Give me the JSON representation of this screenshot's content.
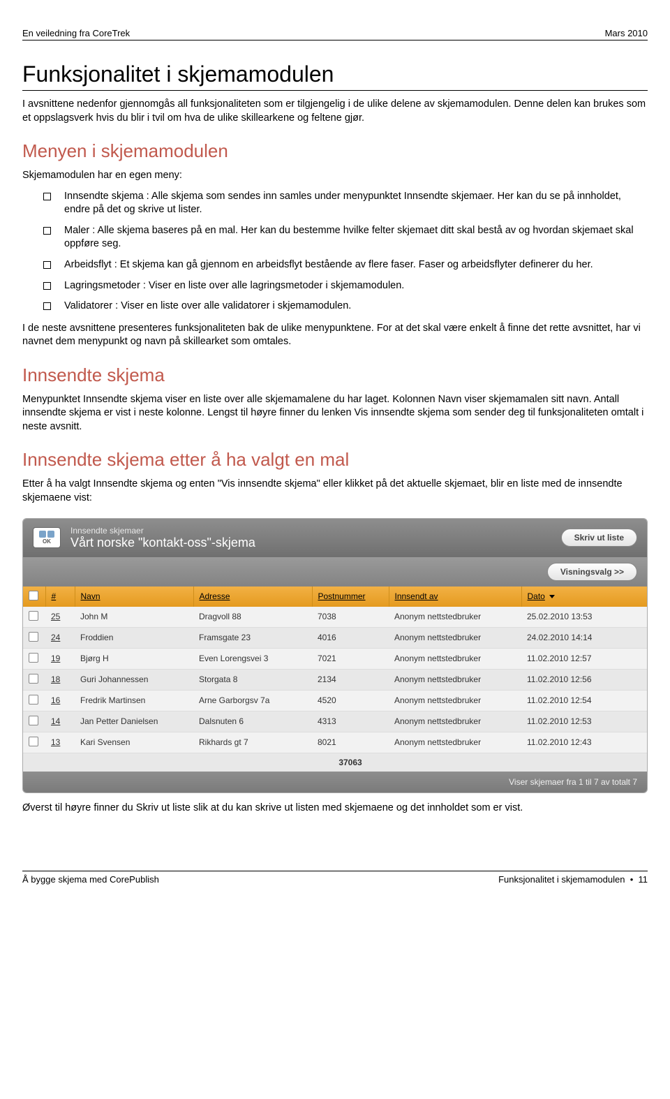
{
  "header": {
    "left": "En veiledning fra CoreTrek",
    "right": "Mars 2010"
  },
  "h1": "Funksjonalitet i skjemamodulen",
  "para1": "I avsnittene nedenfor gjennomgås all funksjonaliteten som er tilgjengelig i de ulike delene av skjemamodulen. Denne delen kan brukes som et oppslagsverk hvis du blir i tvil om hva de ulike skillearkene og feltene gjør.",
  "h2a": "Menyen i skjemamodulen",
  "para2": "Skjemamodulen har en egen meny:",
  "bullets": [
    "Innsendte skjema : Alle skjema som sendes inn samles under menypunktet Innsendte skjemaer. Her kan du se på innholdet, endre på det og skrive ut lister.",
    "Maler : Alle skjema baseres på en mal. Her kan du bestemme hvilke felter skjemaet ditt skal bestå av og hvordan skjemaet skal oppføre seg.",
    "Arbeidsflyt : Et skjema kan gå gjennom en arbeidsflyt bestående av flere faser. Faser og arbeidsflyter definerer du her.",
    "Lagringsmetoder : Viser en liste over alle lagringsmetoder i skjemamodulen.",
    "Validatorer : Viser en liste over alle validatorer i skjemamodulen."
  ],
  "para3": "I de neste avsnittene presenteres funksjonaliteten bak de ulike menypunktene. For at det skal være enkelt å finne det rette avsnittet, har vi navnet dem menypunkt og navn på skillearket som omtales.",
  "h2b": "Innsendte skjema",
  "para4": "Menypunktet Innsendte skjema viser en liste over alle skjemamalene du har laget. Kolonnen Navn viser skjemamalen sitt navn. Antall innsendte skjema er vist i neste kolonne. Lengst til høyre finner du lenken Vis innsendte skjema som sender deg til funksjonaliteten omtalt i neste avsnitt.",
  "h2c": "Innsendte skjema etter å ha valgt en mal",
  "para5": "Etter å ha valgt Innsendte skjema og enten \"Vis innsendte skjema\" eller klikket på det aktuelle skjemaet, blir en liste med de innsendte skjemaene vist:",
  "panel": {
    "ok_label": "OK",
    "breadcrumb": "Innsendte skjemaer",
    "title": "Vårt norske \"kontakt-oss\"-skjema",
    "print_btn": "Skriv ut liste",
    "view_btn": "Visningsvalg >>",
    "columns": {
      "chk": "",
      "num": "#",
      "name": "Navn",
      "address": "Adresse",
      "postcode": "Postnummer",
      "sent_by": "Innsendt av",
      "date": "Dato"
    },
    "rows": [
      {
        "num": "25",
        "name": "John M",
        "address": "Dragvoll 88",
        "postcode": "7038",
        "sent_by": "Anonym nettstedbruker",
        "date": "25.02.2010 13:53"
      },
      {
        "num": "24",
        "name": "Froddien",
        "address": "Framsgate 23",
        "postcode": "4016",
        "sent_by": "Anonym nettstedbruker",
        "date": "24.02.2010 14:14"
      },
      {
        "num": "19",
        "name": "Bjørg H",
        "address": "Even Lorengsvei 3",
        "postcode": "7021",
        "sent_by": "Anonym nettstedbruker",
        "date": "11.02.2010 12:57"
      },
      {
        "num": "18",
        "name": "Guri Johannessen",
        "address": "Storgata 8",
        "postcode": "2134",
        "sent_by": "Anonym nettstedbruker",
        "date": "11.02.2010 12:56"
      },
      {
        "num": "16",
        "name": "Fredrik Martinsen",
        "address": "Arne Garborgsv 7a",
        "postcode": "4520",
        "sent_by": "Anonym nettstedbruker",
        "date": "11.02.2010 12:54"
      },
      {
        "num": "14",
        "name": "Jan Petter Danielsen",
        "address": "Dalsnuten 6",
        "postcode": "4313",
        "sent_by": "Anonym nettstedbruker",
        "date": "11.02.2010 12:53"
      },
      {
        "num": "13",
        "name": "Kari Svensen",
        "address": "Rikhards gt 7",
        "postcode": "8021",
        "sent_by": "Anonym nettstedbruker",
        "date": "11.02.2010 12:43"
      }
    ],
    "footer_sum": "37063",
    "footer_status": "Viser skjemaer fra 1 til 7 av totalt 7"
  },
  "para6": "Øverst til høyre finner du Skriv ut liste slik at du kan skrive ut listen med skjemaene og det innholdet som er vist.",
  "footer": {
    "left": "Å bygge skjema med CorePublish",
    "right_label": "Funksjonalitet i skjemamodulen",
    "right_bullet": "•",
    "right_page": "11"
  }
}
